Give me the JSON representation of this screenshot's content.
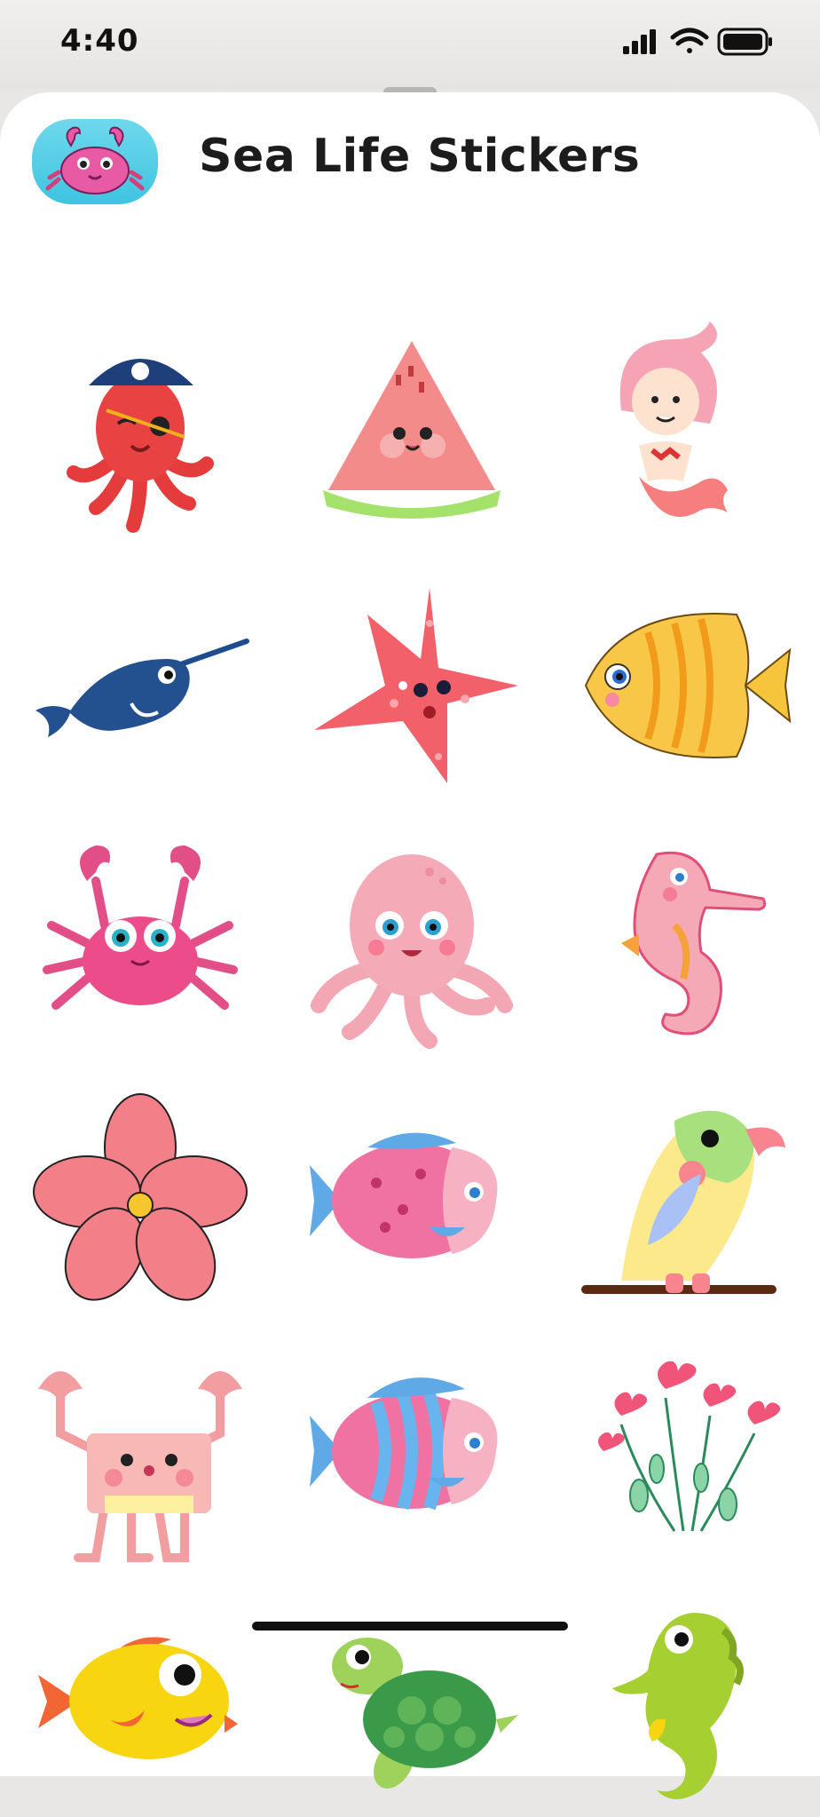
{
  "status_bar": {
    "time": "4:40",
    "icons": [
      "cellular-signal-icon",
      "wifi-icon",
      "battery-icon"
    ]
  },
  "header": {
    "app_icon": "crab-app-icon",
    "title": "Sea Life Stickers"
  },
  "stickers": [
    "pirate-octopus-sticker",
    "watermelon-sticker",
    "mermaid-sticker",
    "narwhal-sticker",
    "starfish-sticker",
    "yellow-fish-sticker",
    "pink-crab-sticker",
    "pink-octopus-sticker",
    "seahorse-pink-sticker",
    "flower-sticker",
    "spotted-fish-sticker",
    "parrot-sticker",
    "square-crab-sticker",
    "striped-fish-sticker",
    "heart-flowers-sticker",
    "orange-yellow-fish-sticker",
    "turtle-sticker",
    "green-seahorse-sticker"
  ],
  "colors": {
    "sheet_background": "#ffffff",
    "status_background": "#eeeceb",
    "title_text": "#1c1c1c",
    "app_icon_background": "#4ec9e4"
  }
}
